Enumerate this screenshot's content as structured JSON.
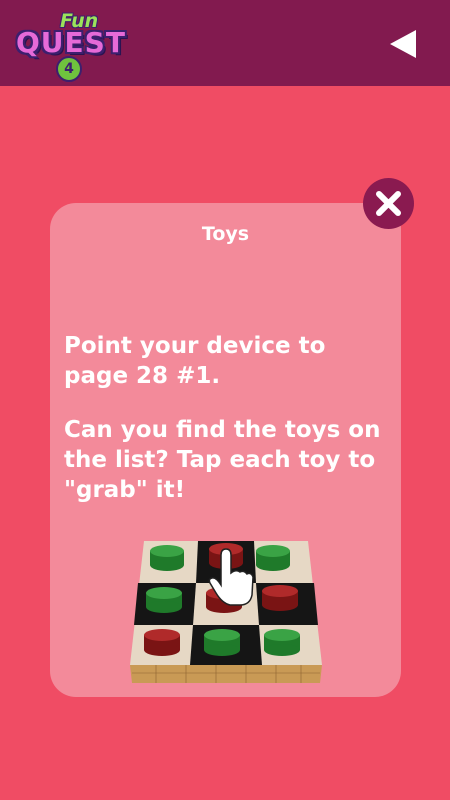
{
  "header": {
    "logo": {
      "line1": "Fun",
      "line2": "QUEST",
      "badge": "4"
    },
    "back_icon": "back-triangle-icon",
    "background_color": "#821a4f"
  },
  "background_color": "#f04c64",
  "modal": {
    "title": "Toys",
    "instruction_line1": "Point your device to page 28 #1.",
    "instruction_line2": "Can you find the toys on the list? Tap each toy to \"grab\" it!",
    "close_icon": "close-x-icon",
    "card_color": "#f38a9a",
    "image": {
      "description_icon": "tictactoe-board-icon",
      "pieces": [
        "green",
        "red",
        "green",
        "green",
        "red",
        "red",
        "red",
        "green",
        "green"
      ]
    }
  }
}
